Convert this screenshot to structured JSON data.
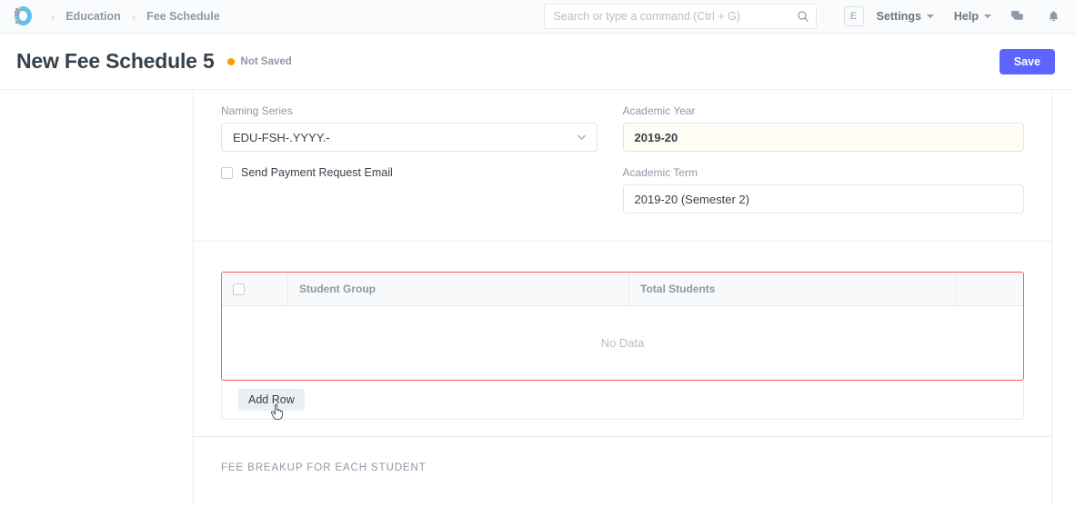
{
  "navbar": {
    "logo_name": "frappe-logo",
    "breadcrumbs": [
      {
        "label": "Education"
      },
      {
        "label": "Fee Schedule"
      }
    ],
    "separator": "›",
    "search": {
      "placeholder": "Search or type a command (Ctrl + G)",
      "value": "",
      "icon": "search-icon"
    },
    "avatar_initial": "E",
    "settings_label": "Settings",
    "help_label": "Help",
    "chat_icon": "chat-icon",
    "notifications_icon": "bell-icon"
  },
  "page_head": {
    "title": "New Fee Schedule 5",
    "status_label": "Not Saved",
    "status_color": "#ff9800",
    "save_label": "Save",
    "save_color": "#5e64ff"
  },
  "form": {
    "naming_series": {
      "label": "Naming Series",
      "value": "EDU-FSH-.YYYY.-",
      "icon": "chevron-down-icon"
    },
    "academic_year": {
      "label": "Academic Year",
      "value": "2019-20"
    },
    "send_payment_request_email": {
      "label": "Send Payment Request Email",
      "checked": false
    },
    "academic_term": {
      "label": "Academic Term",
      "value": "2019-20 (Semester 2)"
    }
  },
  "student_groups_grid": {
    "columns": [
      {
        "label": ""
      },
      {
        "label": "Student Group"
      },
      {
        "label": "Total Students"
      },
      {
        "label": ""
      }
    ],
    "rows": [],
    "empty_text": "No Data",
    "add_row_label": "Add Row",
    "error_border_color": "#ff5858"
  },
  "fee_breakup_section": {
    "heading": "FEE BREAKUP FOR EACH STUDENT"
  }
}
